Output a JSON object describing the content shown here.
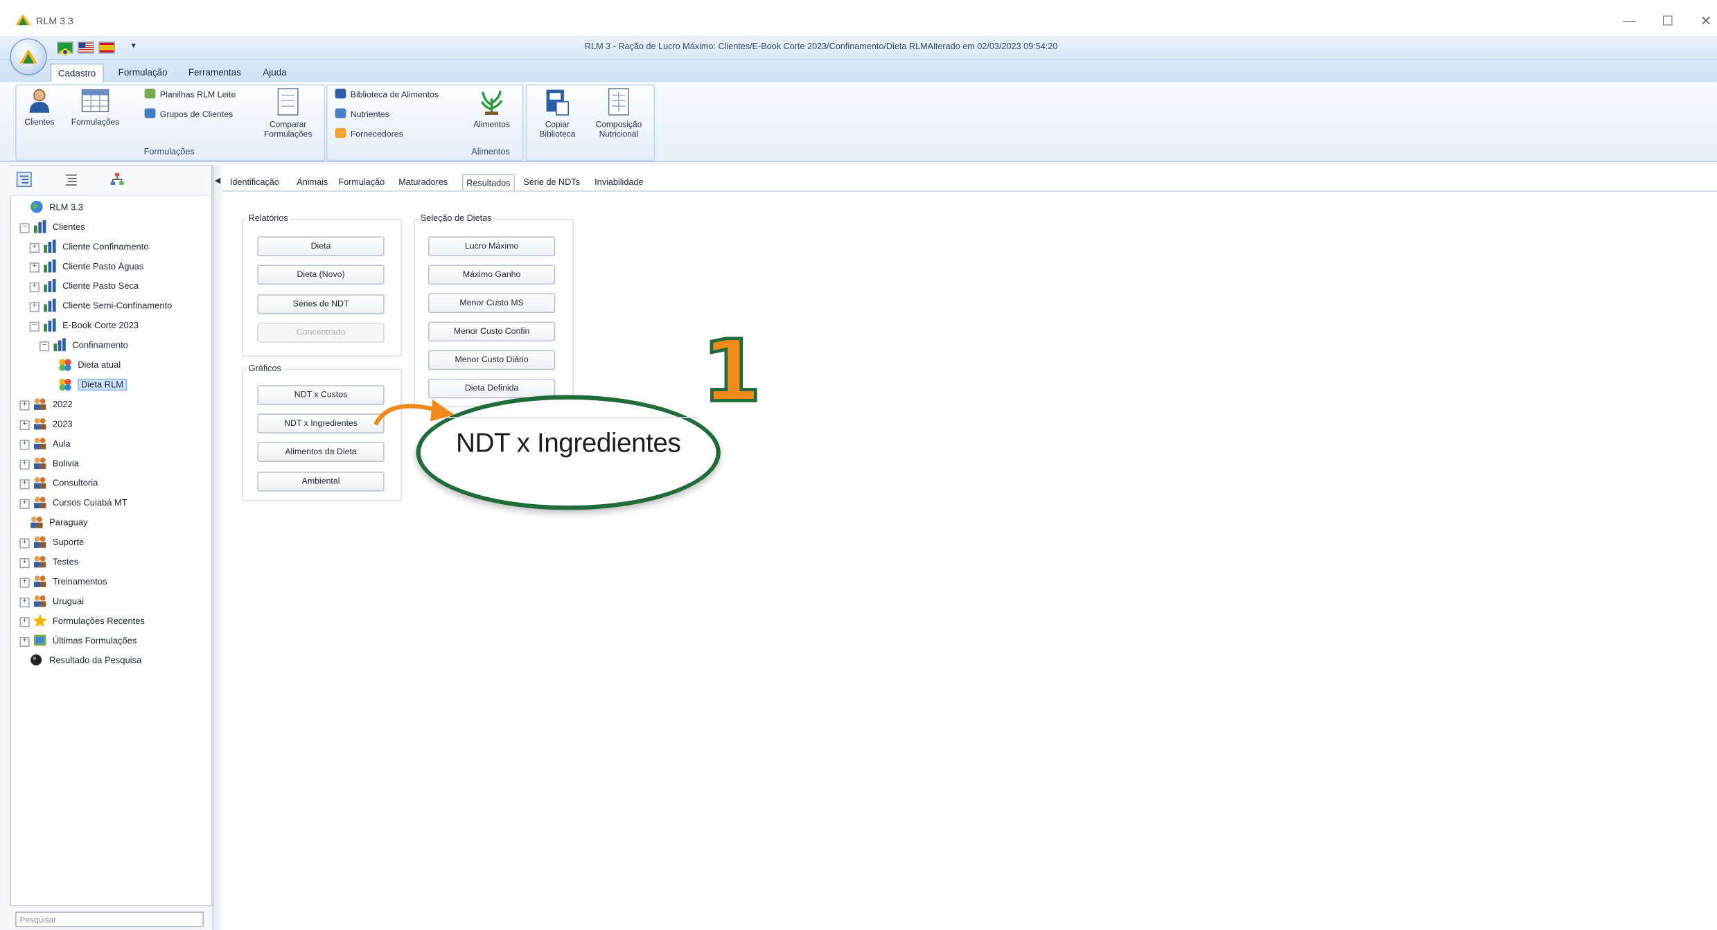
{
  "window": {
    "title": "RLM 3.3",
    "document_title": "RLM 3 - Ração de Lucro Máximo: Clientes/E-Book Corte 2023/Confinamento/Dieta RLMAlterado em 02/03/2023 09:54:20",
    "controls": {
      "minimize": "—",
      "maximize": "☐",
      "close": "✕"
    },
    "qat_arrow": "▾"
  },
  "ribbon": {
    "tabs": [
      "Cadastro",
      "Formulação",
      "Ferramentas",
      "Ajuda"
    ],
    "active_tab": "Cadastro",
    "groups": {
      "formulacoes": {
        "label": "Formulações",
        "clientes": "Clientes",
        "formulacoes": "Formulações",
        "planilhas": "Planilhas RLM Leite",
        "grupos": "Grupos de Clientes",
        "comparar_1": "Comparar",
        "comparar_2": "Formulações"
      },
      "alimentos": {
        "label": "Alimentos",
        "biblioteca": "Biblioteca de Alimentos",
        "nutrientes": "Nutrientes",
        "fornecedores": "Fornecedores",
        "alimentos": "Alimentos"
      },
      "extra": {
        "copiar_1": "Copiar",
        "copiar_2": "Biblioteca",
        "composicao_1": "Composição",
        "composicao_2": "Nutricional"
      }
    }
  },
  "tree": {
    "nodes": [
      {
        "label": "RLM 3.3"
      },
      {
        "label": "Clientes"
      },
      {
        "label": "Cliente Confinamento"
      },
      {
        "label": "Cliente Pasto Águas"
      },
      {
        "label": "Cliente Pasto Seca"
      },
      {
        "label": "Cliente Semi-Confinamento"
      },
      {
        "label": "E-Book Corte 2023"
      },
      {
        "label": "Confinamento"
      },
      {
        "label": "Dieta atual"
      },
      {
        "label": "Dieta RLM"
      },
      {
        "label": "2022"
      },
      {
        "label": "2023"
      },
      {
        "label": "Aula"
      },
      {
        "label": "Bolivia"
      },
      {
        "label": "Consultoria"
      },
      {
        "label": "Cursos Cuiabá MT"
      },
      {
        "label": "Paraguay"
      },
      {
        "label": "Suporte"
      },
      {
        "label": "Testes"
      },
      {
        "label": "Treinamentos"
      },
      {
        "label": "Uruguai"
      },
      {
        "label": "Formulações Recentes"
      },
      {
        "label": "Últimas Formulações"
      },
      {
        "label": "Resultado da Pesquisa"
      }
    ],
    "selected": "Dieta RLM",
    "search_placeholder": "Pesquisar"
  },
  "content": {
    "tabs": [
      "Identificação",
      "Animais",
      "Formulação",
      "Maturadores",
      "Resultados",
      "Série de NDTs",
      "Inviabilidade"
    ],
    "active_tab": "Resultados",
    "relatorios": {
      "legend": "Relatórios",
      "buttons": [
        "Dieta",
        "Dieta (Novo)",
        "Séries de NDT",
        "Concentrado"
      ]
    },
    "graficos": {
      "legend": "Gráficos",
      "buttons": [
        "NDT x Custos",
        "NDT x Ingredientes",
        "Alimentos da Dieta",
        "Ambiental"
      ]
    },
    "selecao": {
      "legend": "Seleção de Dietas",
      "buttons": [
        "Lucro Máximo",
        "Máximo Ganho",
        "Menor Custo MS",
        "Menor Custo Confin",
        "Menor Custo Diário",
        "Dieta Definida"
      ]
    }
  },
  "callout": {
    "step_number": "1",
    "text": "NDT x Ingredientes"
  },
  "colors": {
    "accent_green": "#1f6b3a",
    "accent_orange": "#f08a1c",
    "ribbon_blue": "#cfe1f5"
  }
}
